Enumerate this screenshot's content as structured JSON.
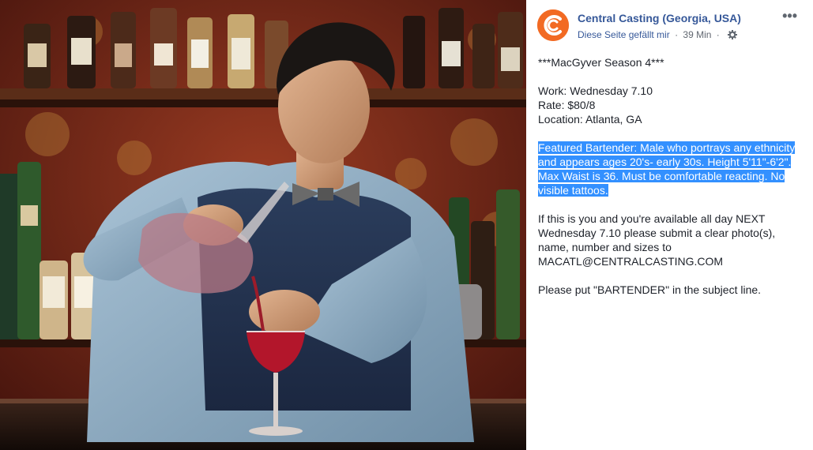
{
  "post": {
    "page_name": "Central Casting (Georgia, USA)",
    "likes_label": "Diese Seite gefällt mir",
    "separator": "·",
    "time": "39 Min",
    "more_label": "•••",
    "title_line": "***MacGyver Season 4***",
    "work_line": "Work: Wednesday 7.10",
    "rate_line": "Rate: $80/8",
    "location_line": "Location: Atlanta, GA",
    "highlight_lines": [
      "Featured Bartender: Male who portrays any ethnicity",
      "and appears ages 20's- early 30s. Height 5'11\"-6'2\".",
      "Max Waist is 36. Must be comfortable reacting. No",
      "visible tattoos."
    ],
    "apply_lines": [
      "If this is you and you're available all day NEXT",
      "Wednesday 7.10 please submit a clear photo(s),",
      "name, number and sizes to",
      "MACATL@CENTRALCASTING.COM"
    ],
    "subject_line": "Please put \"BARTENDER\" in the subject line."
  },
  "colors": {
    "brand_orange": "#f26a23",
    "link_blue": "#365899",
    "highlight_blue": "#3390ff"
  },
  "icons": {
    "logo": "central-casting-logo",
    "gear": "gear-icon",
    "more": "more-options-icon"
  }
}
